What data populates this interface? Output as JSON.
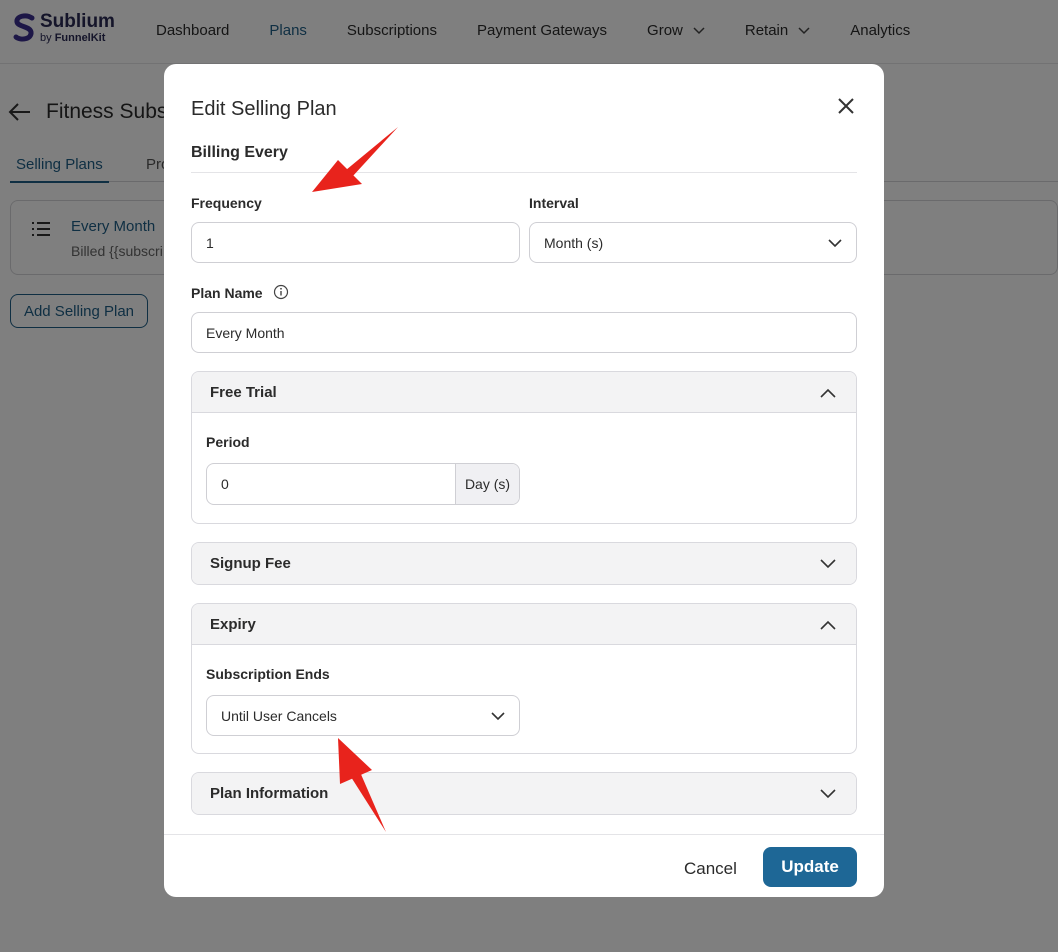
{
  "brand": {
    "name": "Sublium",
    "by": "by",
    "sub": "FunnelKit"
  },
  "nav": [
    {
      "label": "Dashboard",
      "active": false,
      "dropdown": false
    },
    {
      "label": "Plans",
      "active": true,
      "dropdown": false
    },
    {
      "label": "Subscriptions",
      "active": false,
      "dropdown": false
    },
    {
      "label": "Payment Gateways",
      "active": false,
      "dropdown": false
    },
    {
      "label": "Grow",
      "active": false,
      "dropdown": true
    },
    {
      "label": "Retain",
      "active": false,
      "dropdown": true
    },
    {
      "label": "Analytics",
      "active": false,
      "dropdown": false
    }
  ],
  "page": {
    "title": "Fitness Subsc",
    "tabs": [
      "Selling Plans",
      "Pro"
    ],
    "plan_card": {
      "title": "Every Month",
      "subtitle": "Billed {{subscri"
    },
    "add_button": "Add Selling Plan"
  },
  "modal": {
    "title": "Edit Selling Plan",
    "section": "Billing Every",
    "frequency": {
      "label": "Frequency",
      "value": "1"
    },
    "interval": {
      "label": "Interval",
      "value": "Month (s)"
    },
    "plan_name": {
      "label": "Plan Name",
      "value": "Every Month"
    },
    "free_trial": {
      "title": "Free Trial",
      "period_label": "Period",
      "period_value": "0",
      "period_unit": "Day (s)"
    },
    "signup_fee": {
      "title": "Signup Fee"
    },
    "expiry": {
      "title": "Expiry",
      "ends_label": "Subscription Ends",
      "ends_value": "Until User Cancels"
    },
    "plan_information": {
      "title": "Plan Information"
    },
    "cancel": "Cancel",
    "update": "Update"
  },
  "colors": {
    "accent": "#1e6796",
    "active_nav": "#1e5e86",
    "annotation": "#e8231c"
  }
}
